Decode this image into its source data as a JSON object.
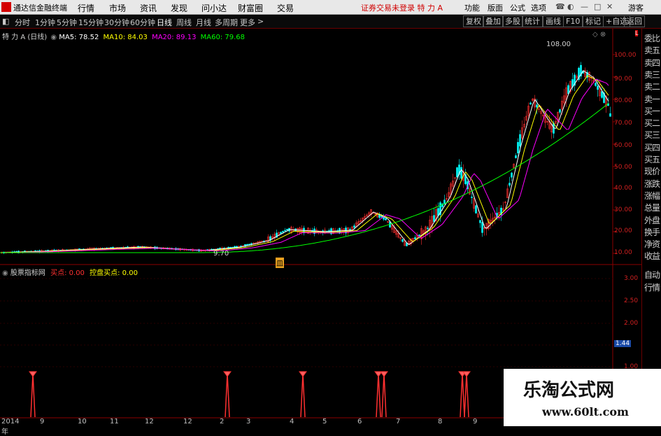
{
  "menubar": {
    "app_title": "通达信金融终端",
    "items": [
      "行情",
      "市场",
      "资讯",
      "发现",
      "问小达",
      "财富圈",
      "交易"
    ],
    "notice": "证券交易未登录  特 力 A",
    "right_items": [
      "功能",
      "版面",
      "公式",
      "选项"
    ],
    "guest": "游客"
  },
  "toolbar": {
    "periods": [
      "分时",
      "1分钟",
      "5分钟",
      "15分钟",
      "30分钟",
      "60分钟",
      "日线",
      "周线",
      "月线",
      "多周期",
      "更多"
    ],
    "active": "日线",
    "buttons": [
      "复权",
      "叠加",
      "多股",
      "统计",
      "画线",
      "F10",
      "标记",
      "+自选",
      "返回"
    ]
  },
  "main_info": {
    "name": "特 力 A (日线)",
    "ma5": "MA5: 78.52",
    "ma10": "MA10: 84.03",
    "ma20": "MA20: 89.13",
    "ma60": "MA60: 79.68"
  },
  "annotations": {
    "high": "108.00",
    "low": "9.70",
    "marker": "皿"
  },
  "indicator_info": {
    "name": "股票指标网",
    "buy": "买点: 0.00",
    "control": "控盘买点: 0.00"
  },
  "price_axis": [
    "100.00",
    "90.00",
    "80.00",
    "70.00",
    "60.00",
    "50.00",
    "40.00",
    "30.00",
    "20.00",
    "10.00"
  ],
  "indicator_axis": [
    "3.00",
    "2.50",
    "2.00",
    "1.50",
    "1.00"
  ],
  "indicator_current": "1.44",
  "x_axis": [
    "2014年",
    "9",
    "10",
    "11",
    "12",
    "2",
    "3",
    "4",
    "5",
    "6",
    "7",
    "8",
    "9"
  ],
  "side_panel": [
    "委比",
    "卖五",
    "卖四",
    "卖三",
    "卖二",
    "卖一",
    "买一",
    "买二",
    "买三",
    "买四",
    "买五",
    "现价",
    "涨跌",
    "涨幅",
    "总量",
    "外盘",
    "换手",
    "净资",
    "收益"
  ],
  "side_panel_bottom": [
    "自动",
    "行情"
  ],
  "watermark": {
    "title": "乐淘公式网",
    "url": "www.60lt.com"
  },
  "colors": {
    "ma5": "#ffffff",
    "ma10": "#ffff00",
    "ma20": "#ff00ff",
    "ma60": "#00ff00",
    "up": "#ff3030",
    "down": "#00ffff",
    "axis": "#8b0000"
  }
}
